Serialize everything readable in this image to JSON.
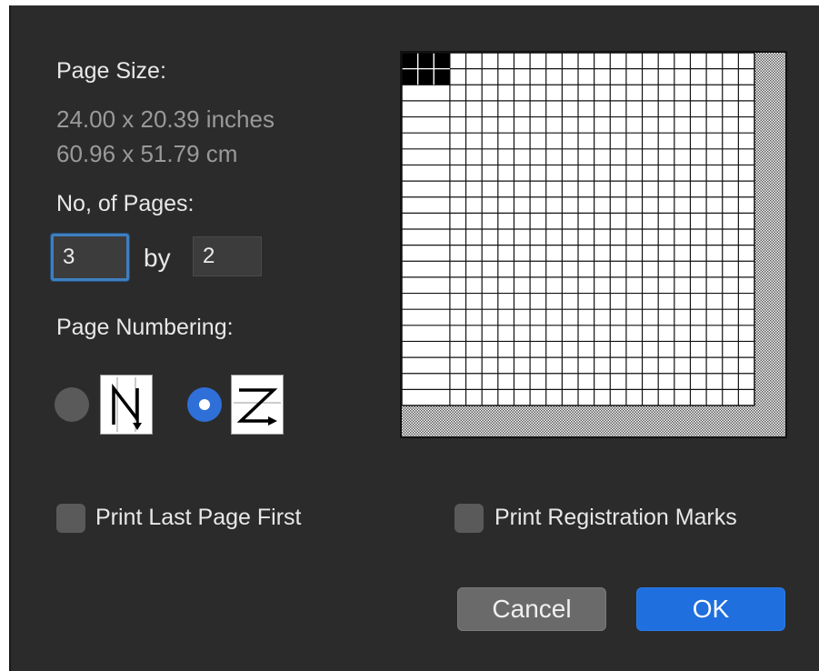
{
  "page_size": {
    "heading": "Page Size:",
    "inches": "24.00 x 20.39 inches",
    "cm": "60.96 x 51.79 cm"
  },
  "pages": {
    "heading": "No, of Pages:",
    "across_value": "3",
    "by_label": "by",
    "down_value": "2"
  },
  "numbering": {
    "heading": "Page Numbering:",
    "options": [
      {
        "icon": "column-order-icon",
        "selected": false
      },
      {
        "icon": "row-order-icon",
        "selected": true
      }
    ]
  },
  "options": {
    "print_last_page_first": {
      "label": "Print Last Page First",
      "checked": false
    },
    "print_registration_marks": {
      "label": "Print Registration Marks",
      "checked": false
    }
  },
  "buttons": {
    "cancel": "Cancel",
    "ok": "OK"
  },
  "preview": {
    "grid_columns": 22,
    "grid_rows": 22,
    "selected_columns": 3,
    "selected_rows": 2,
    "colors": {
      "selected": "#000000",
      "grid": "#111111",
      "background": "#ffffff"
    }
  },
  "colors": {
    "dialog_bg": "#2b2b2b",
    "accent": "#1f6fde",
    "focus_ring": "#3f7fbf"
  }
}
